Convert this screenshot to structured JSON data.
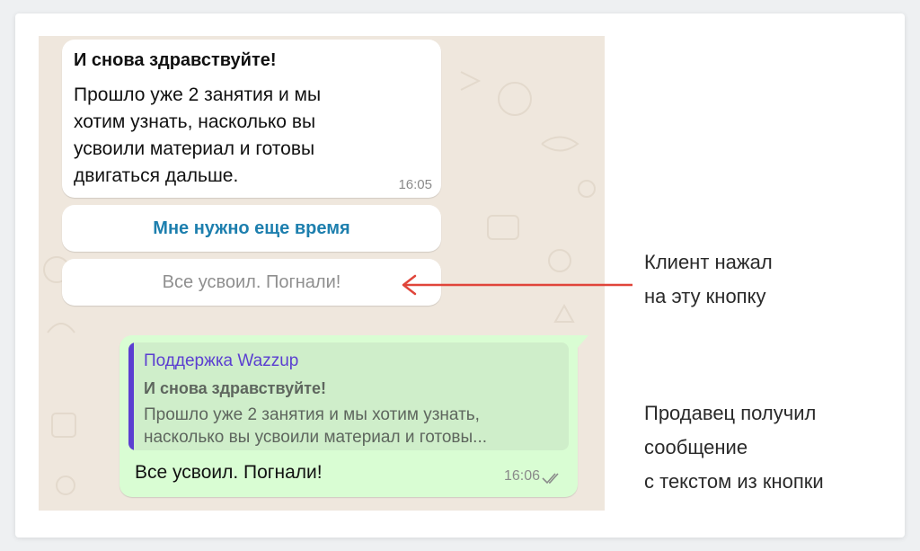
{
  "incoming": {
    "title": "И снова здравствуйте!",
    "lines": [
      "Прошло уже 2 занятия и мы",
      "хотим узнать, насколько вы",
      "усвоили материал и готовы",
      "двигаться дальше."
    ],
    "time": "16:05"
  },
  "quick_replies": [
    {
      "label": "Мне нужно еще время",
      "state": "active"
    },
    {
      "label": "Все усвоил. Погнали!",
      "state": "pressed"
    }
  ],
  "outgoing": {
    "quote_author": "Поддержка Wazzup",
    "quote_title": "И снова здравствуйте!",
    "quote_lines": [
      "Прошло уже 2 занятия и мы хотим узнать,",
      "насколько вы усвоили материал и готовы..."
    ],
    "message": "Все усвоил. Погнали!",
    "time": "16:06",
    "status_icon": "double-check-icon"
  },
  "annotations": [
    {
      "lines": [
        "Клиент нажал",
        "на эту кнопку"
      ]
    },
    {
      "lines": [
        "Продавец получил",
        "сообщение",
        "с текстом из кнопки"
      ]
    }
  ],
  "colors": {
    "chat_bg": "#efe7dd",
    "outgoing_bg": "#d9fdd3",
    "link_blue": "#1d7fae",
    "quote_accent": "#5b3fd1",
    "arrow_red": "#e0453a"
  }
}
